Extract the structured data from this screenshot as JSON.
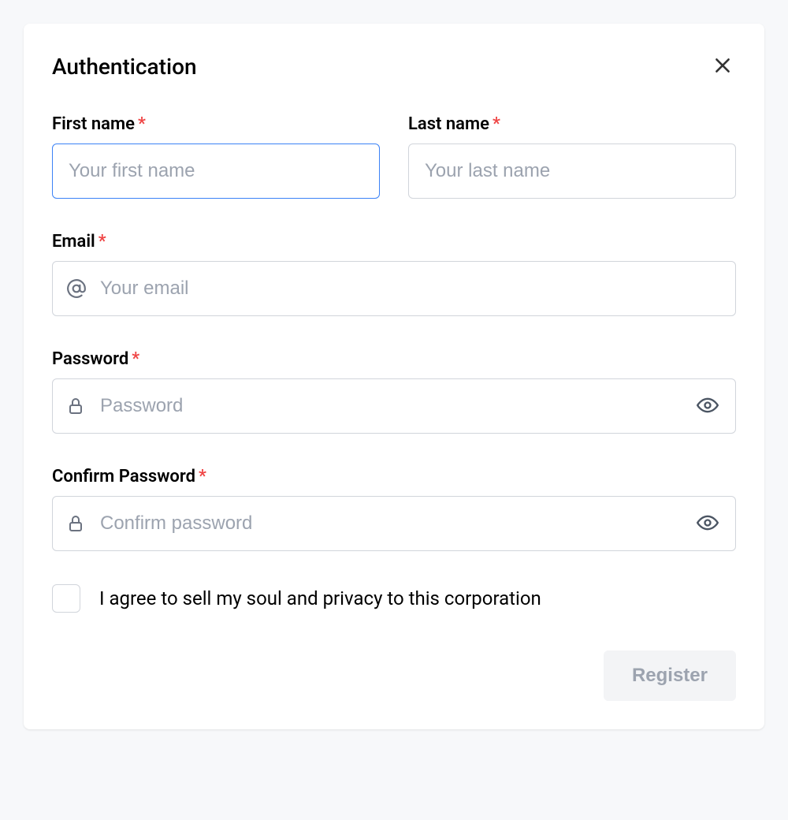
{
  "modal": {
    "title": "Authentication"
  },
  "fields": {
    "first_name": {
      "label": "First name",
      "placeholder": "Your first name",
      "value": ""
    },
    "last_name": {
      "label": "Last name",
      "placeholder": "Your last name",
      "value": ""
    },
    "email": {
      "label": "Email",
      "placeholder": "Your email",
      "value": ""
    },
    "password": {
      "label": "Password",
      "placeholder": "Password",
      "value": ""
    },
    "confirm_password": {
      "label": "Confirm Password",
      "placeholder": "Confirm password",
      "value": ""
    }
  },
  "required_marker": "*",
  "agreement": {
    "label": "I agree to sell my soul and privacy to this corporation"
  },
  "actions": {
    "register": "Register"
  }
}
